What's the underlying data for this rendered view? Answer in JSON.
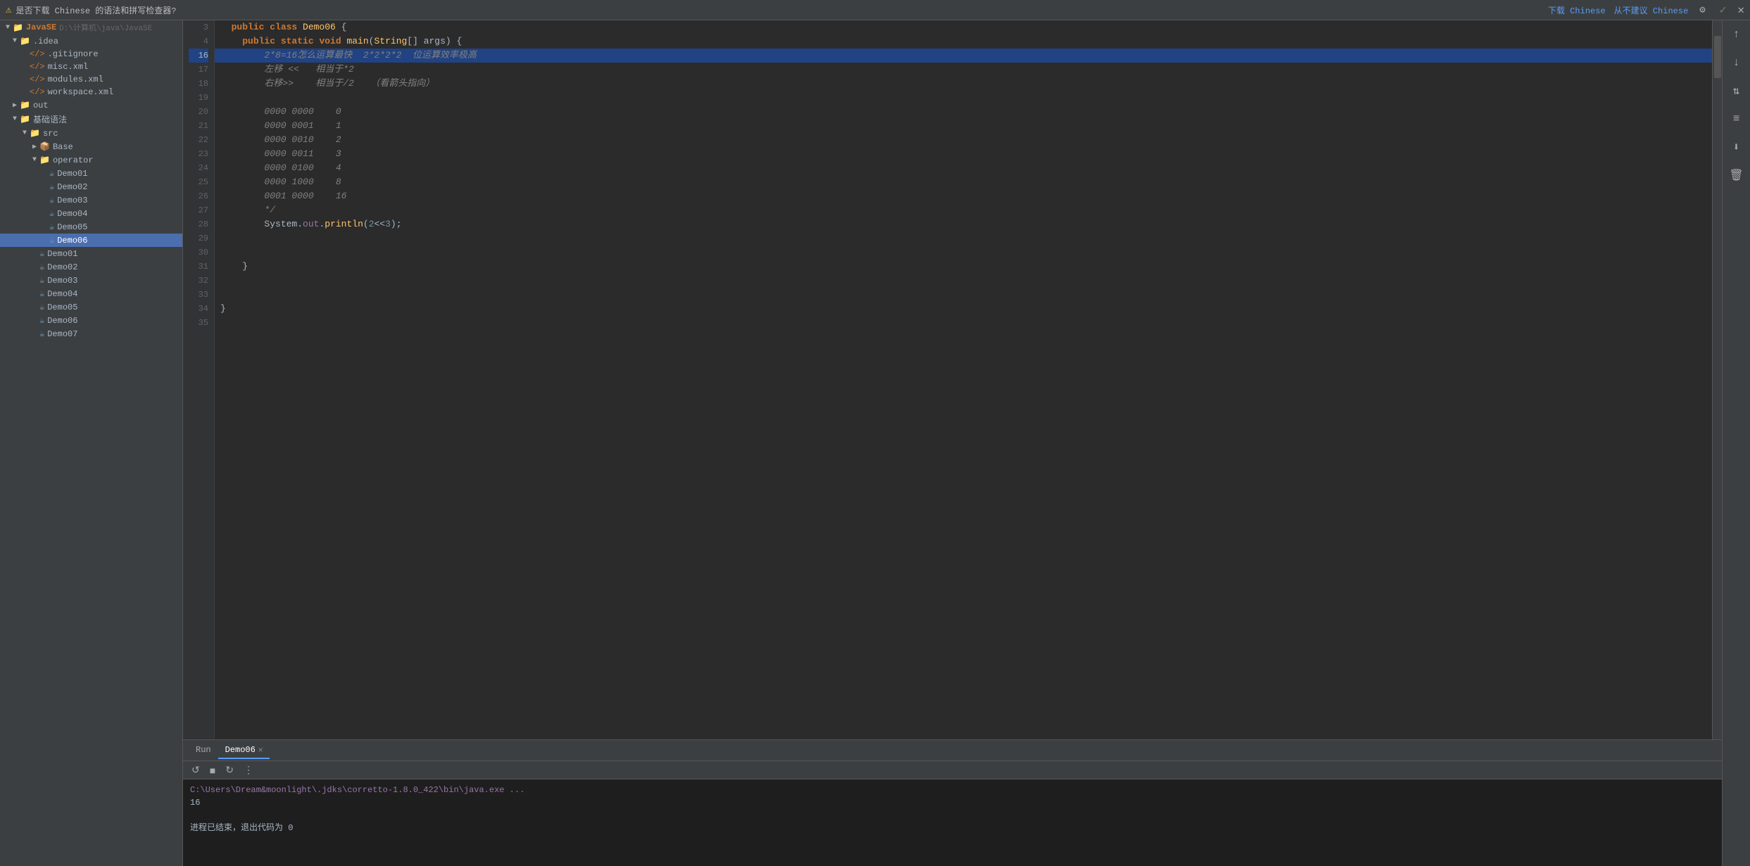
{
  "notification": {
    "icon": "⚠",
    "text": "是否下载 Chinese 的语法和拼写检查器?",
    "download_label": "下载 Chinese",
    "separator": "",
    "dismiss_label": "从不建议 Chinese",
    "settings_icon": "⚙",
    "check_icon": "✓",
    "close_icon": "✕"
  },
  "sidebar": {
    "root_label": "JavaSE",
    "root_path": "D:\\计算机\\java\\JavaSE",
    "items": [
      {
        "id": "idea",
        "label": ".idea",
        "type": "folder",
        "depth": 1,
        "expanded": true
      },
      {
        "id": "gitignore",
        "label": ".gitignore",
        "type": "file-xml",
        "depth": 2
      },
      {
        "id": "misc",
        "label": "misc.xml",
        "type": "file-xml",
        "depth": 2
      },
      {
        "id": "modules",
        "label": "modules.xml",
        "type": "file-xml",
        "depth": 2
      },
      {
        "id": "workspace",
        "label": "workspace.xml",
        "type": "file-xml",
        "depth": 2
      },
      {
        "id": "out",
        "label": "out",
        "type": "folder",
        "depth": 1,
        "expanded": false
      },
      {
        "id": "基础语法",
        "label": "基础语法",
        "type": "folder",
        "depth": 1,
        "expanded": true
      },
      {
        "id": "src",
        "label": "src",
        "type": "folder",
        "depth": 2,
        "expanded": true
      },
      {
        "id": "Base",
        "label": "Base",
        "type": "package",
        "depth": 3
      },
      {
        "id": "operator",
        "label": "operator",
        "type": "folder",
        "depth": 3,
        "expanded": true
      },
      {
        "id": "Demo01",
        "label": "Demo01",
        "type": "java",
        "depth": 4
      },
      {
        "id": "Demo02",
        "label": "Demo02",
        "type": "java",
        "depth": 4
      },
      {
        "id": "Demo03",
        "label": "Demo03",
        "type": "java",
        "depth": 4
      },
      {
        "id": "Demo04",
        "label": "Demo04",
        "type": "java",
        "depth": 4
      },
      {
        "id": "Demo05",
        "label": "Demo05",
        "type": "java",
        "depth": 4
      },
      {
        "id": "Demo06-active",
        "label": "Demo06",
        "type": "java",
        "depth": 4,
        "active": true
      },
      {
        "id": "Demo01b",
        "label": "Demo01",
        "type": "java",
        "depth": 3
      },
      {
        "id": "Demo02b",
        "label": "Demo02",
        "type": "java",
        "depth": 3
      },
      {
        "id": "Demo03b",
        "label": "Demo03",
        "type": "java",
        "depth": 3
      },
      {
        "id": "Demo04b",
        "label": "Demo04",
        "type": "java",
        "depth": 3
      },
      {
        "id": "Demo05b",
        "label": "Demo05",
        "type": "java",
        "depth": 3
      },
      {
        "id": "Demo06b",
        "label": "Demo06",
        "type": "java",
        "depth": 3
      },
      {
        "id": "Demo07b",
        "label": "Demo07",
        "type": "java",
        "depth": 3
      }
    ]
  },
  "editor": {
    "lines": [
      {
        "num": 3,
        "tokens": [
          {
            "t": "  "
          },
          {
            "t": "public ",
            "c": "kw"
          },
          {
            "t": "class ",
            "c": "kw"
          },
          {
            "t": "Demo06",
            "c": "cls"
          },
          {
            "t": " {",
            "c": "op"
          }
        ]
      },
      {
        "num": 4,
        "tokens": [
          {
            "t": "    "
          },
          {
            "t": "public ",
            "c": "kw"
          },
          {
            "t": "static ",
            "c": "kw"
          },
          {
            "t": "void ",
            "c": "kw"
          },
          {
            "t": "main",
            "c": "fn"
          },
          {
            "t": "(",
            "c": "op"
          },
          {
            "t": "String",
            "c": "cls"
          },
          {
            "t": "[] args) {",
            "c": "op"
          }
        ]
      },
      {
        "num": 16,
        "tokens": [
          {
            "t": "        2*8=16怎么运算最快  2*2*2*2  位运算效率极高",
            "c": "cmt"
          }
        ],
        "highlighted": true
      },
      {
        "num": 17,
        "tokens": [
          {
            "t": "        左移 <<   相当于*2",
            "c": "cmt"
          }
        ]
      },
      {
        "num": 18,
        "tokens": [
          {
            "t": "        右移>>    相当于/2   （看箭头指向）",
            "c": "cmt"
          }
        ]
      },
      {
        "num": 19,
        "tokens": []
      },
      {
        "num": 20,
        "tokens": [
          {
            "t": "        0000 0000    0",
            "c": "cmt"
          }
        ]
      },
      {
        "num": 21,
        "tokens": [
          {
            "t": "        0000 0001    1",
            "c": "cmt"
          }
        ]
      },
      {
        "num": 22,
        "tokens": [
          {
            "t": "        0000 0010    2",
            "c": "cmt"
          }
        ]
      },
      {
        "num": 23,
        "tokens": [
          {
            "t": "        0000 0011    3",
            "c": "cmt"
          }
        ]
      },
      {
        "num": 24,
        "tokens": [
          {
            "t": "        0000 0100    4",
            "c": "cmt"
          }
        ]
      },
      {
        "num": 25,
        "tokens": [
          {
            "t": "        0000 1000    8",
            "c": "cmt"
          }
        ]
      },
      {
        "num": 26,
        "tokens": [
          {
            "t": "        0001 0000    16",
            "c": "cmt"
          }
        ]
      },
      {
        "num": 27,
        "tokens": [
          {
            "t": "        */",
            "c": "cmt"
          }
        ]
      },
      {
        "num": 28,
        "tokens": [
          {
            "t": "        "
          },
          {
            "t": "System",
            "c": "var"
          },
          {
            "t": ".",
            "c": "op"
          },
          {
            "t": "out",
            "c": "field"
          },
          {
            "t": ".",
            "c": "op"
          },
          {
            "t": "println",
            "c": "fn"
          },
          {
            "t": "(",
            "c": "op"
          },
          {
            "t": "2",
            "c": "num"
          },
          {
            "t": "<<",
            "c": "op"
          },
          {
            "t": "3",
            "c": "num"
          },
          {
            "t": ");",
            "c": "op"
          }
        ]
      },
      {
        "num": 29,
        "tokens": []
      },
      {
        "num": 30,
        "tokens": []
      },
      {
        "num": 31,
        "tokens": [
          {
            "t": "    }",
            "c": "op"
          }
        ]
      },
      {
        "num": 32,
        "tokens": []
      },
      {
        "num": 33,
        "tokens": []
      },
      {
        "num": 34,
        "tokens": [
          {
            "t": "}",
            "c": "op"
          }
        ]
      },
      {
        "num": 35,
        "tokens": []
      }
    ]
  },
  "bottom_panel": {
    "tabs": [
      {
        "id": "run",
        "label": "Run",
        "active": false
      },
      {
        "id": "demo06",
        "label": "Demo06",
        "active": true,
        "closable": true
      }
    ],
    "toolbar_buttons": [
      "↺",
      "■",
      "↻",
      "⋮"
    ],
    "terminal_lines": [
      {
        "type": "cmd",
        "text": "C:\\Users\\Dream&moonlight\\.jdks\\corretto-1.8.0_422\\bin\\java.exe ..."
      },
      {
        "type": "output",
        "text": "16"
      },
      {
        "type": "output",
        "text": ""
      },
      {
        "type": "status",
        "text": "进程已结束，退出代码为 0"
      }
    ]
  },
  "activity_bar": {
    "buttons": [
      "↑",
      "↓",
      "↑↓",
      "≡↓",
      "📥",
      "🗑"
    ]
  },
  "colors": {
    "accent": "#589df6",
    "highlight_line": "#214283",
    "sidebar_bg": "#3c3f41",
    "editor_bg": "#2b2b2b",
    "active_item": "#4b6eaf"
  }
}
